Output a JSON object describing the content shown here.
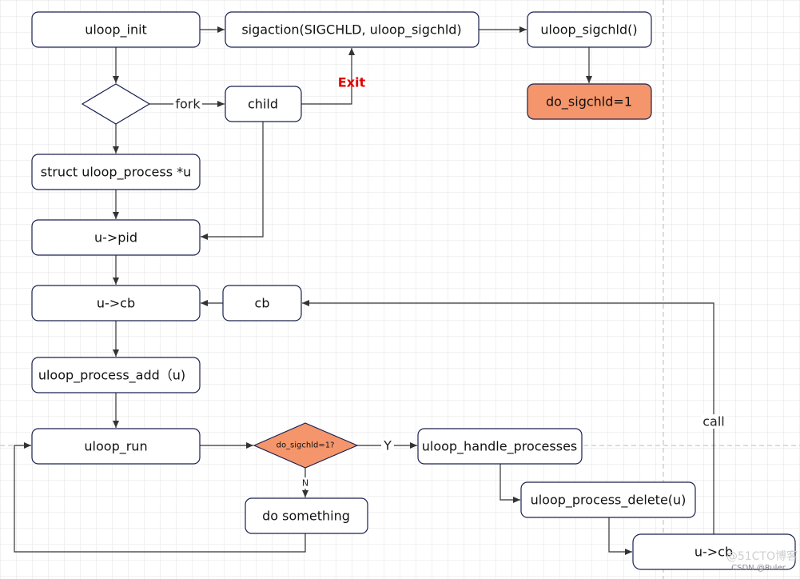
{
  "colors": {
    "node_fill": "#ffffff",
    "highlight_fill": "#f4956b",
    "exit_label": "#e00000",
    "border": "#1a2150"
  },
  "nodes": {
    "uloop_init": "uloop_init",
    "sigaction": "sigaction(SIGCHLD, uloop_sigchld)",
    "uloop_sigchld": "uloop_sigchld()",
    "do_sigchld_set": "do_sigchld=1",
    "child": "child",
    "struct_uloop_process": "struct uloop_process *u",
    "u_pid": "u->pid",
    "u_cb": "u->cb",
    "cb": "cb",
    "uloop_process_add": "uloop_process_add（u)",
    "uloop_run": "uloop_run",
    "do_sigchld_check": "do_sigchld=1?",
    "uloop_handle_processes": "uloop_handle_processes",
    "do_something": "do something",
    "uloop_process_delete": "uloop_process_delete(u)",
    "u_cb_call": "u->cb"
  },
  "edge_labels": {
    "fork": "fork",
    "exit": "Exit",
    "yes": "Y",
    "no": "N",
    "call": "call"
  },
  "watermark": {
    "line1": "@51CTO博客",
    "line2": "CSDN @Ruler."
  }
}
